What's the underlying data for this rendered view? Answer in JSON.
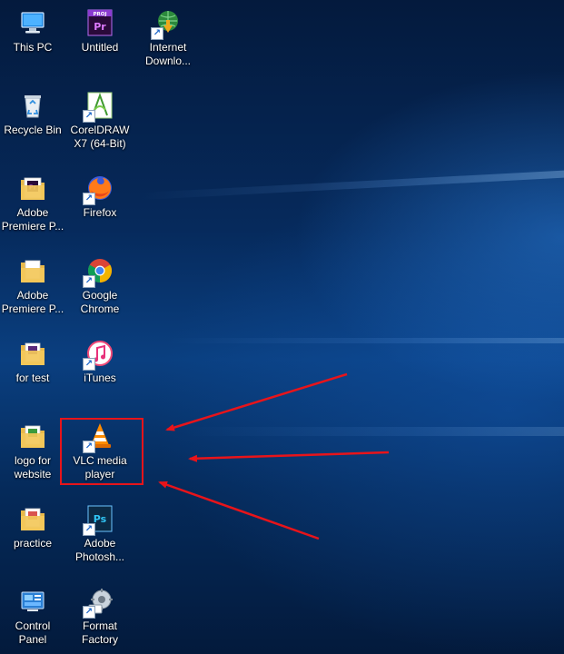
{
  "desktop": {
    "icons": [
      {
        "label": "This PC",
        "icon": "computer-icon"
      },
      {
        "label": "Untitled",
        "icon": "premiere-project-icon",
        "badge": "PROJ",
        "glyph": "Pr"
      },
      {
        "label": "Internet\nDownlo...",
        "icon": "internet-download-manager-icon"
      },
      {
        "label": "Recycle Bin",
        "icon": "recycle-bin-icon"
      },
      {
        "label": "CorelDRAW\nX7 (64-Bit)",
        "icon": "coreldraw-icon"
      },
      {
        "label": "Adobe\nPremiere P...",
        "icon": "folder-icon",
        "glyph": "Pr"
      },
      {
        "label": "Firefox",
        "icon": "firefox-icon"
      },
      {
        "label": "Adobe\nPremiere P...",
        "icon": "folder-icon"
      },
      {
        "label": "Google\nChrome",
        "icon": "chrome-icon"
      },
      {
        "label": "for test",
        "icon": "folder-icon"
      },
      {
        "label": "iTunes",
        "icon": "itunes-icon"
      },
      {
        "label": "logo for\nwebsite",
        "icon": "folder-icon"
      },
      {
        "label": "VLC media\nplayer",
        "icon": "vlc-icon"
      },
      {
        "label": "practice",
        "icon": "folder-icon"
      },
      {
        "label": "Adobe\nPhotosh...",
        "icon": "photoshop-icon",
        "glyph": "Ps"
      },
      {
        "label": "Control\nPanel",
        "icon": "control-panel-icon"
      },
      {
        "label": "Format\nFactory",
        "icon": "format-factory-icon"
      }
    ]
  },
  "colors": {
    "highlight": "#e8141a",
    "label_text": "#ffffff",
    "shortcut_arrow": "#1a64c8"
  }
}
